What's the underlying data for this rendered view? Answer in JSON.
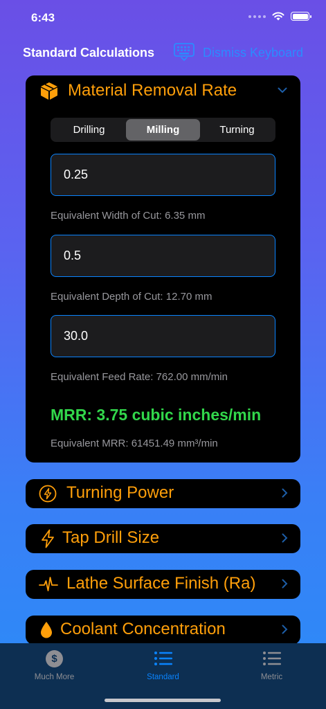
{
  "status": {
    "time": "6:43"
  },
  "nav": {
    "title": "Standard Calculations",
    "dismiss_label": "Dismiss Keyboard"
  },
  "mrr": {
    "title": "Material Removal Rate",
    "segments": [
      "Drilling",
      "Milling",
      "Turning"
    ],
    "selected_segment": "Milling",
    "width_value": "0.25",
    "width_helper": "Equivalent Width of Cut: 6.35 mm",
    "depth_value": "0.5",
    "depth_helper": "Equivalent Depth of Cut: 12.70 mm",
    "feed_value": "30.0",
    "feed_helper": "Equivalent Feed Rate: 762.00 mm/min",
    "result": "MRR: 3.75 cubic inches/min",
    "equivalent": "Equivalent MRR: 61451.49 mm³/min"
  },
  "calculators": [
    {
      "title": "Turning Power",
      "icon": "bolt-circle-icon"
    },
    {
      "title": "Tap Drill Size",
      "icon": "bolt-icon"
    },
    {
      "title": "Lathe Surface Finish (Ra)",
      "icon": "waveform-icon"
    },
    {
      "title": "Coolant Concentration",
      "icon": "drop-icon"
    }
  ],
  "tabs": [
    {
      "label": "Much More",
      "icon": "dollar-circle-icon",
      "active": false
    },
    {
      "label": "Standard",
      "icon": "list-icon",
      "active": true
    },
    {
      "label": "Metric",
      "icon": "list-icon",
      "active": false
    }
  ],
  "colors": {
    "accent": "#ff9f0a",
    "link": "#0a84ff",
    "result": "#32d74b"
  }
}
